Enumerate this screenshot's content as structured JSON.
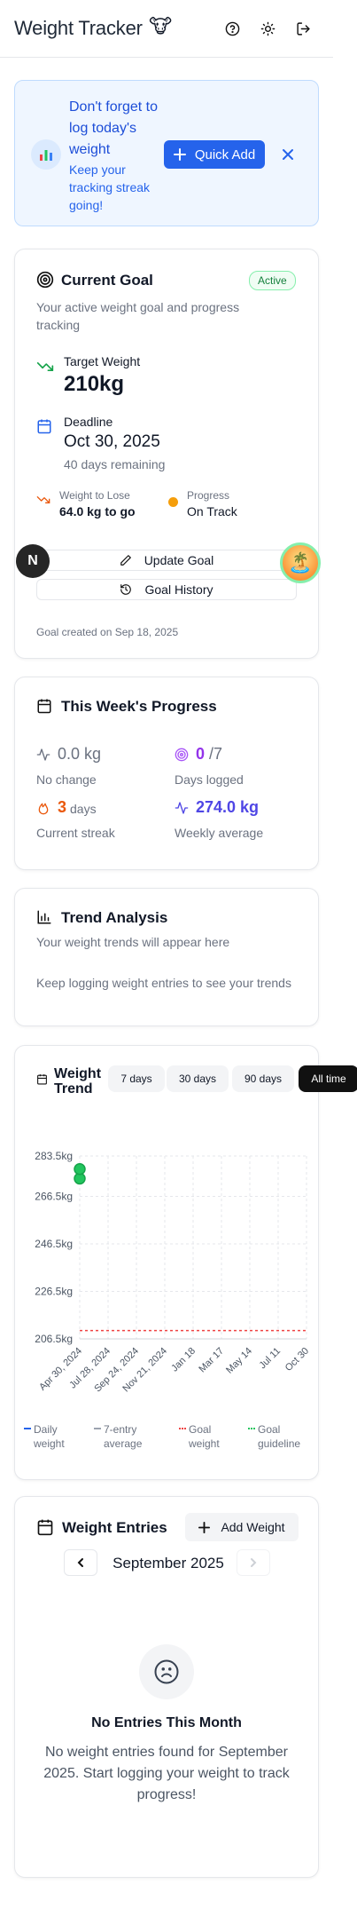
{
  "header": {
    "title": "Weight Tracker",
    "emoji": "🐮",
    "icons": [
      "help-icon",
      "sun-icon",
      "logout-icon"
    ]
  },
  "reminder": {
    "title": "Don't forget to log today's weight",
    "subtitle": "Keep your tracking streak going!",
    "quick_add_label": "Quick Add"
  },
  "goal": {
    "title": "Current Goal",
    "status": "Active",
    "description": "Your active weight goal and progress tracking",
    "target_label": "Target Weight",
    "target_value": "210kg",
    "deadline_label": "Deadline",
    "deadline_value": "Oct 30, 2025",
    "days_remaining": "40 days remaining",
    "to_lose_label": "Weight to Lose",
    "to_lose_value": "64.0 kg to go",
    "progress_label": "Progress",
    "progress_value": "On Track",
    "update_label": "Update Goal",
    "history_label": "Goal History",
    "created": "Goal created on Sep 18, 2025"
  },
  "avatar_letter": "N",
  "island_emoji": "🏝️",
  "week": {
    "title": "This Week's Progress",
    "change_value": "0.0 kg",
    "change_label": "No change",
    "days_logged_value": "0",
    "days_logged_total": "/7",
    "days_logged_label": "Days logged",
    "streak_value": "3",
    "streak_unit": "days",
    "streak_label": "Current streak",
    "avg_value": "274.0 kg",
    "avg_label": "Weekly average"
  },
  "trend_analysis": {
    "title": "Trend Analysis",
    "subtitle": "Your weight trends will appear here",
    "message": "Keep logging weight entries to see your trends"
  },
  "chart_section": {
    "title": "Weight Trend",
    "ranges": [
      "7 days",
      "30 days",
      "90 days",
      "All time"
    ],
    "active_range": "All time"
  },
  "chart_data": {
    "type": "line",
    "y_ticks": [
      "283.5kg",
      "266.5kg",
      "246.5kg",
      "226.5kg",
      "206.5kg"
    ],
    "y_tick_values": [
      283.5,
      266.5,
      246.5,
      226.5,
      206.5
    ],
    "ylim": [
      206.5,
      283.5
    ],
    "x_ticks": [
      "Apr 30, 2024",
      "Jul 28, 2024",
      "Sep 24, 2024",
      "Nov 21, 2024",
      "Jan 18",
      "Mar 17",
      "May 14",
      "Jul 11",
      "Oct 30"
    ],
    "series": [
      {
        "name": "Daily weight",
        "color": "#2563eb",
        "points": [
          {
            "x": "Apr 30, 2024",
            "y": 274
          },
          {
            "x": "Apr 30, 2024",
            "y": 278
          }
        ]
      },
      {
        "name": "7-entry average",
        "color": "#9ca3af",
        "points": []
      },
      {
        "name": "Goal weight",
        "color": "#ef4444",
        "value": 210
      },
      {
        "name": "Goal guideline",
        "color": "#22c55e",
        "points": []
      }
    ],
    "grid": true,
    "legend": "bottom"
  },
  "entries": {
    "title": "Weight Entries",
    "add_label": "Add Weight",
    "month": "September 2025",
    "empty_title": "No Entries This Month",
    "empty_message": "No weight entries found for September 2025. Start logging your weight to track progress!"
  }
}
